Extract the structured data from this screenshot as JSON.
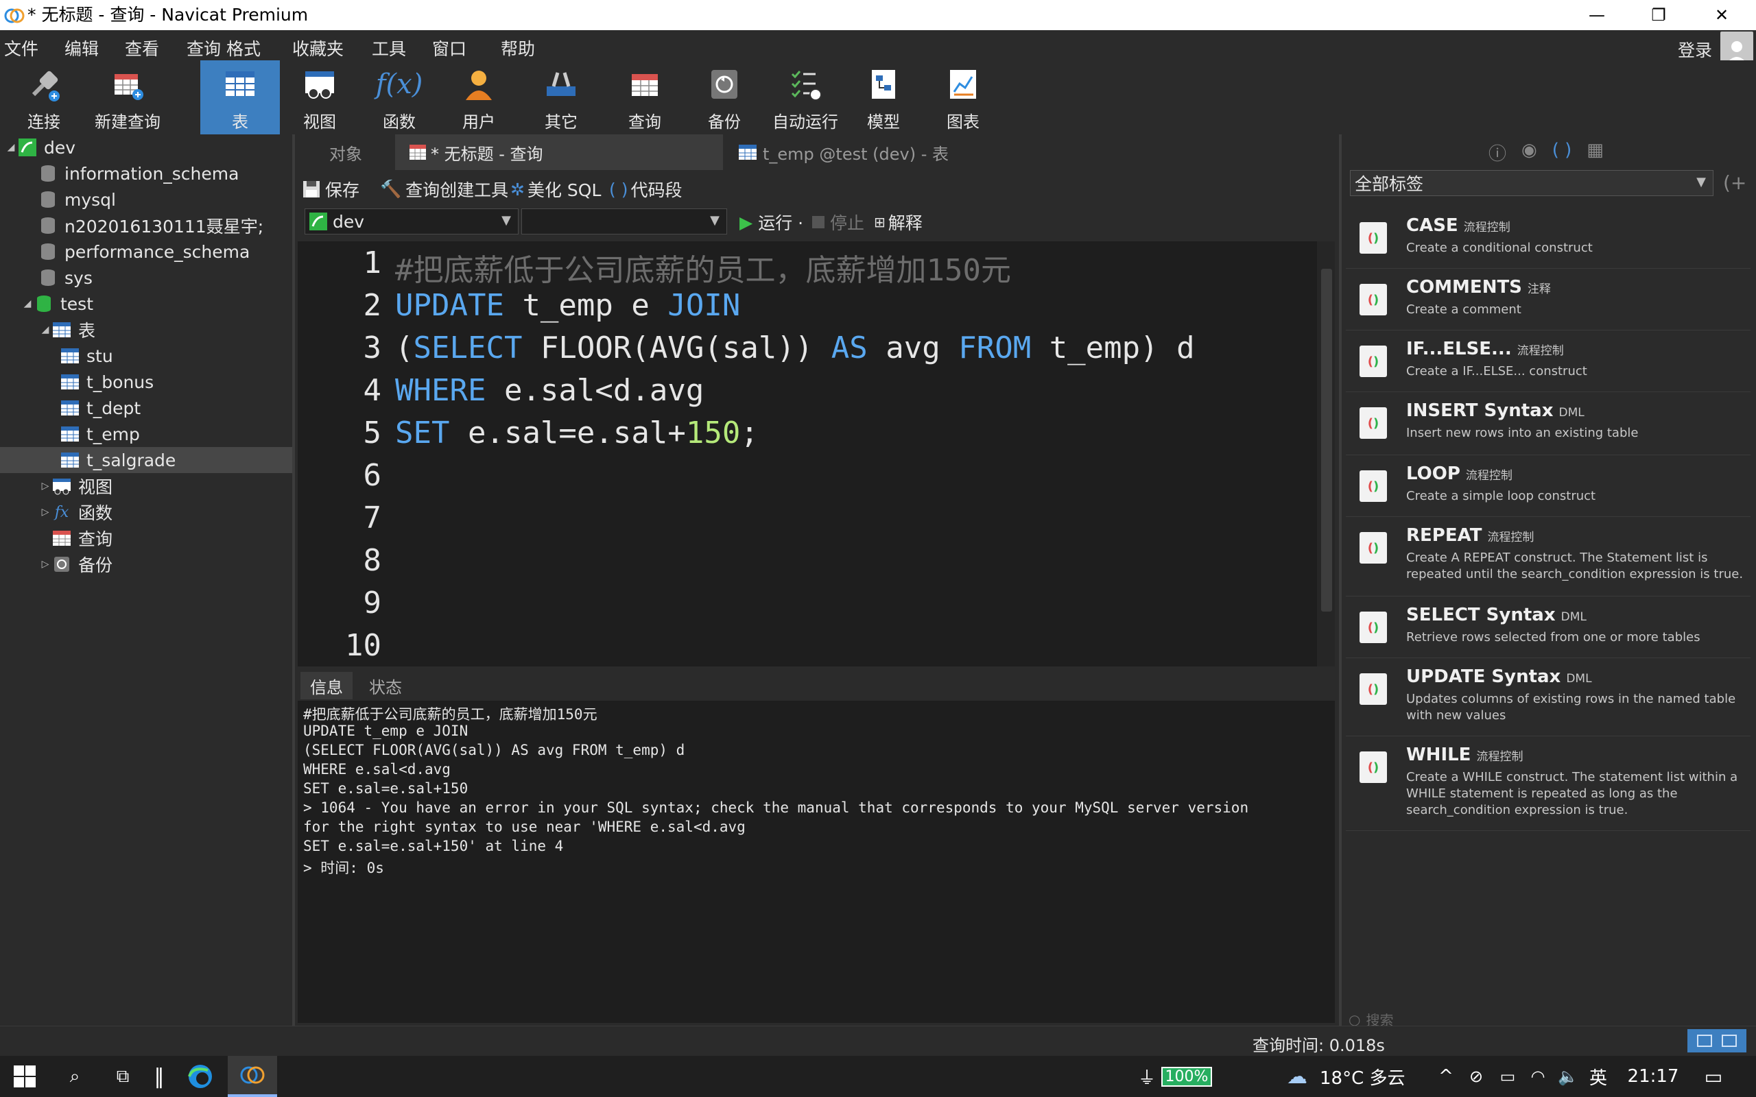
{
  "window": {
    "title": "* 无标题 - 查询 - Navicat Premium"
  },
  "menu": {
    "items": [
      "文件",
      "编辑",
      "查看",
      "查询",
      "格式",
      "收藏夹",
      "工具",
      "窗口",
      "帮助"
    ],
    "login": "登录"
  },
  "toolbar": {
    "items": [
      "连接",
      "新建查询",
      "表",
      "视图",
      "函数",
      "用户",
      "其它",
      "查询",
      "备份",
      "自动运行",
      "模型",
      "图表"
    ],
    "active": "表"
  },
  "tree": {
    "connection": "dev",
    "databases": [
      "information_schema",
      "mysql",
      "n202016130111聂星宇;",
      "performance_schema",
      "sys",
      "test"
    ],
    "tables_folder": "表",
    "tables": [
      "stu",
      "t_bonus",
      "t_dept",
      "t_emp",
      "t_salgrade"
    ],
    "selected": "t_salgrade",
    "other_folders": [
      "视图",
      "函数",
      "查询",
      "备份"
    ]
  },
  "tabs": {
    "objects": "对象",
    "query": "* 无标题 - 查询",
    "table": "t_emp @test (dev) - 表"
  },
  "query_toolbar": {
    "save": "保存",
    "builder": "查询创建工具",
    "beautify": "美化 SQL",
    "snippet": "代码段",
    "run": "运行 ·",
    "stop": "停止",
    "explain": "解释"
  },
  "db_selector": {
    "connection": "dev",
    "database": ""
  },
  "editor": {
    "line_numbers": [
      "1",
      "2",
      "3",
      "4",
      "5",
      "6",
      "7",
      "8",
      "9",
      "10"
    ],
    "lines": [
      "#把底薪低于公司底薪的员工，底薪增加150元",
      "UPDATE t_emp e JOIN",
      "(SELECT FLOOR(AVG(sal)) AS avg FROM t_emp) d",
      "WHERE e.sal<d.avg",
      "SET e.sal=e.sal+150;"
    ]
  },
  "results": {
    "tabs": [
      "信息",
      "状态"
    ],
    "lines": [
      "#把底薪低于公司底薪的员工，底薪增加150元",
      "UPDATE t_emp e JOIN",
      "(SELECT FLOOR(AVG(sal)) AS avg FROM t_emp) d",
      "WHERE e.sal<d.avg",
      "SET e.sal=e.sal+150",
      "> 1064 - You have an error in your SQL syntax; check the manual that corresponds to your MySQL server version",
      "for the right syntax to use near 'WHERE e.sal<d.avg",
      "SET e.sal=e.sal+150' at line 4",
      "> 时间: 0s"
    ]
  },
  "snippets": {
    "filter": "全部标签",
    "search_placeholder": "搜索",
    "items": [
      {
        "name": "CASE",
        "category": "流程控制",
        "desc": "Create a conditional construct"
      },
      {
        "name": "COMMENTS",
        "category": "注释",
        "desc": "Create a comment"
      },
      {
        "name": "IF...ELSE...",
        "category": "流程控制",
        "desc": "Create a IF...ELSE... construct"
      },
      {
        "name": "INSERT Syntax",
        "category": "DML",
        "desc": "Insert new rows into an existing table"
      },
      {
        "name": "LOOP",
        "category": "流程控制",
        "desc": "Create a simple loop construct"
      },
      {
        "name": "REPEAT",
        "category": "流程控制",
        "desc": "Create A REPEAT construct. The Statement list is repeated until the search_condition expression is true."
      },
      {
        "name": "SELECT Syntax",
        "category": "DML",
        "desc": "Retrieve rows selected from one or more tables"
      },
      {
        "name": "UPDATE Syntax",
        "category": "DML",
        "desc": "Updates columns of existing rows in the named table with new values"
      },
      {
        "name": "WHILE",
        "category": "流程控制",
        "desc": "Create a WHILE construct. The statement list within a WHILE statement is repeated as long as the search_condition expression is true."
      }
    ]
  },
  "status": {
    "query_time": "查询时间: 0.018s"
  },
  "taskbar": {
    "battery": "100%",
    "weather": "18°C 多云",
    "ime": "英",
    "clock": "21:17"
  }
}
